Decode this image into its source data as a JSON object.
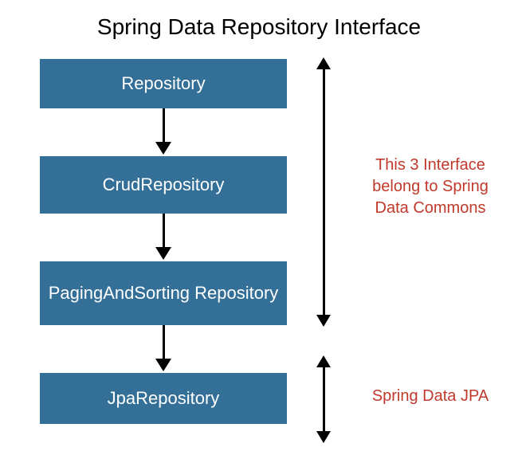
{
  "title": "Spring Data Repository Interface",
  "boxes": {
    "b1": "Repository",
    "b2": "CrudRepository",
    "b3": "PagingAndSorting Repository",
    "b4": "JpaRepository"
  },
  "annotations": {
    "a1": "This 3 Interface belong to Spring Data Commons",
    "a2": "Spring Data JPA"
  },
  "colors": {
    "box_bg": "#336f96",
    "annotation": "#c0392b"
  }
}
